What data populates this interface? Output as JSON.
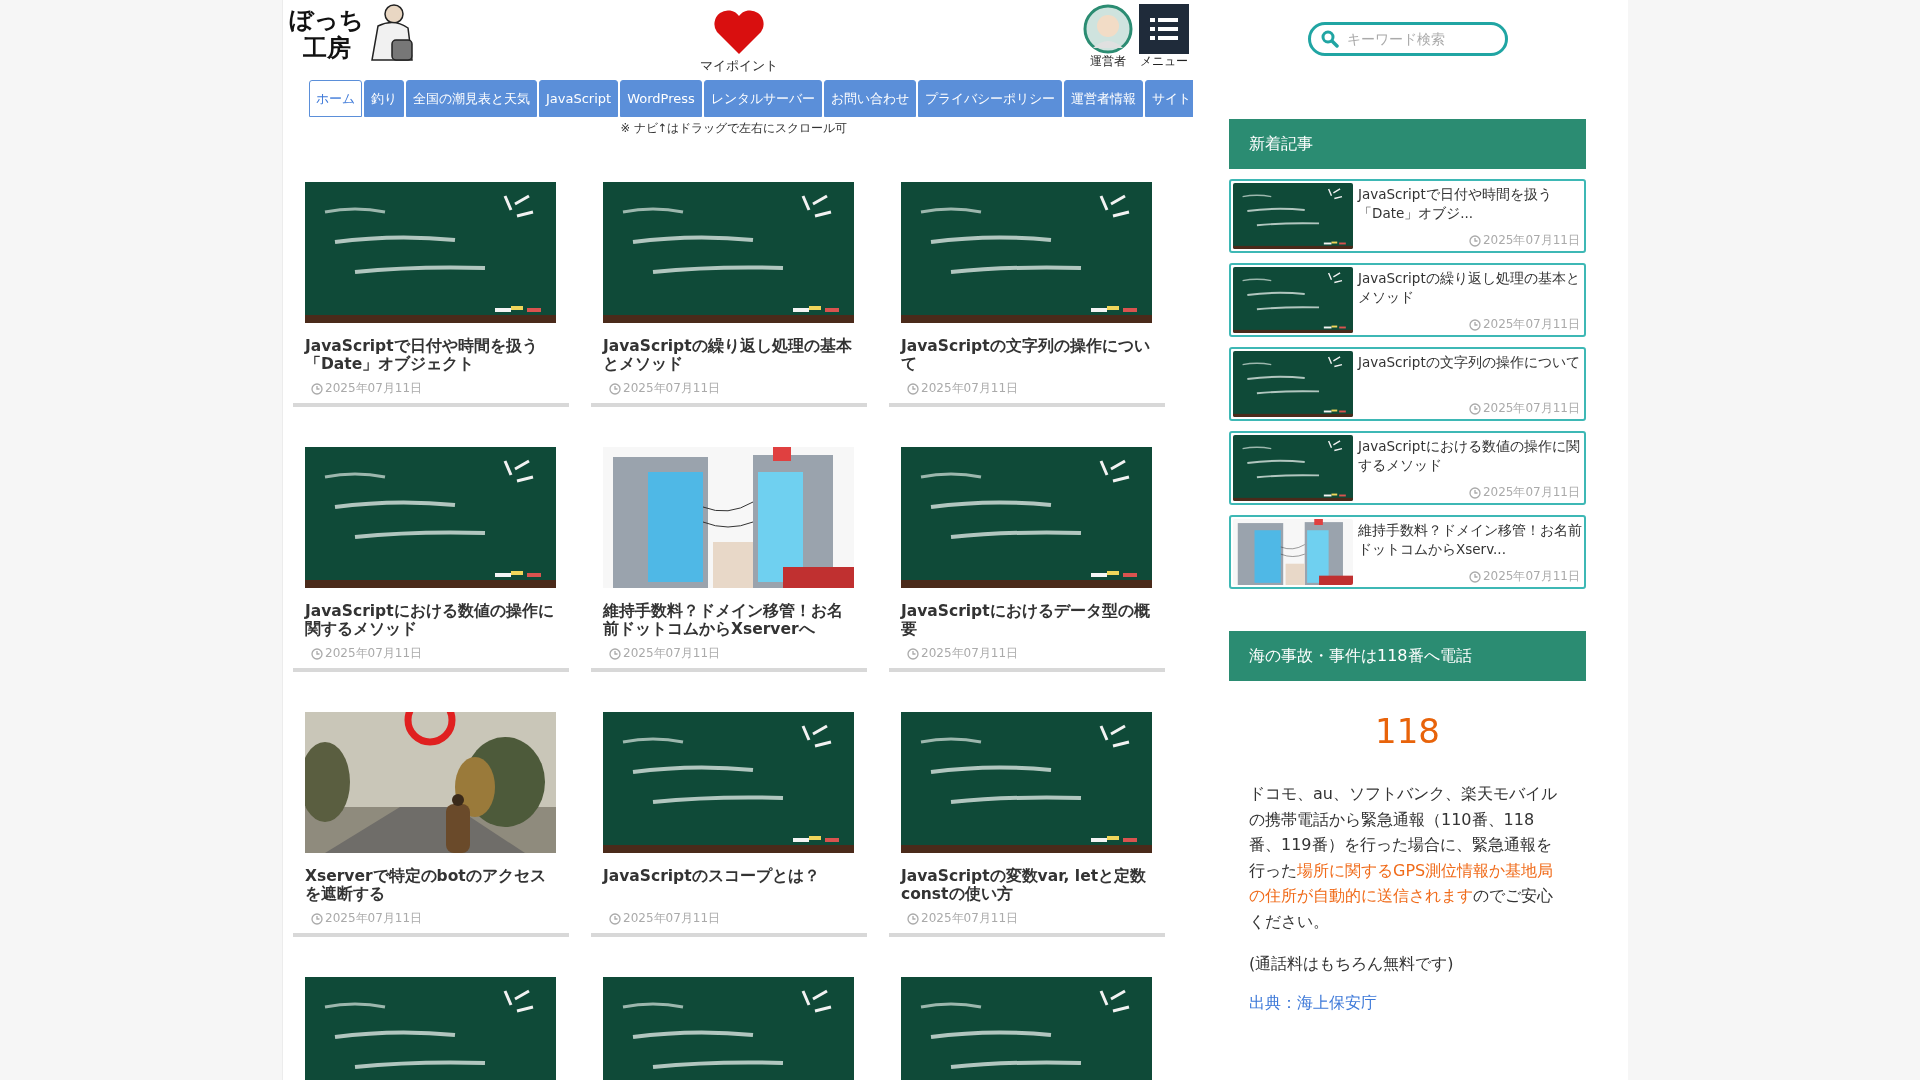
{
  "header": {
    "logo_lines": [
      "ぼっち",
      "工房"
    ],
    "mypoint_label": "マイポイント",
    "operator_label": "運営者",
    "menu_label": "メニュー"
  },
  "nav": {
    "tabs": [
      {
        "label": "ホーム",
        "selected": true
      },
      {
        "label": "釣り",
        "selected": false
      },
      {
        "label": "全国の潮見表と天気",
        "selected": false
      },
      {
        "label": "JavaScript",
        "selected": false
      },
      {
        "label": "WordPress",
        "selected": false
      },
      {
        "label": "レンタルサーバー",
        "selected": false
      },
      {
        "label": "お問い合わせ",
        "selected": false
      },
      {
        "label": "プライバシーポリシー",
        "selected": false
      },
      {
        "label": "運営者情報",
        "selected": false
      },
      {
        "label": "サイト",
        "selected": false
      }
    ],
    "note": "※ ナビ↑はドラッグで左右にスクロール可"
  },
  "articles": [
    {
      "kind": "chalkboard",
      "title": "JavaScriptで日付や時間を扱う「Date」オブジェクト",
      "date": "2025年07月11日"
    },
    {
      "kind": "chalkboard",
      "title": "JavaScriptの繰り返し処理の基本とメソッド",
      "date": "2025年07月11日"
    },
    {
      "kind": "chalkboard",
      "title": "JavaScriptの文字列の操作について",
      "date": "2025年07月11日"
    },
    {
      "kind": "chalkboard",
      "title": "JavaScriptにおける数値の操作に関するメソッド",
      "date": "2025年07月11日"
    },
    {
      "kind": "buildings",
      "title": "維持手数料？ドメイン移管！お名前ドットコムからXserverへ",
      "date": "2025年07月11日"
    },
    {
      "kind": "chalkboard",
      "title": "JavaScriptにおけるデータ型の概要",
      "date": "2025年07月11日"
    },
    {
      "kind": "road",
      "title": "Xserverで特定のbotのアクセスを遮断する",
      "date": "2025年07月11日"
    },
    {
      "kind": "chalkboard",
      "title": "JavaScriptのスコープとは？",
      "date": "2025年07月11日"
    },
    {
      "kind": "chalkboard",
      "title": "JavaScriptの変数var, letと定数constの使い方",
      "date": "2025年07月11日"
    },
    {
      "kind": "chalkboard"
    },
    {
      "kind": "chalkboard"
    },
    {
      "kind": "chalkboard"
    }
  ],
  "sidebar": {
    "search": {
      "placeholder": "キーワード検索"
    },
    "recent": {
      "title": "新着記事",
      "items": [
        {
          "kind": "chalkboard",
          "title": "JavaScriptで日付や時間を扱う「Date」オブジ...",
          "date": "2025年07月11日"
        },
        {
          "kind": "chalkboard",
          "title": "JavaScriptの繰り返し処理の基本とメソッド",
          "date": "2025年07月11日"
        },
        {
          "kind": "chalkboard",
          "title": "JavaScriptの文字列の操作について",
          "date": "2025年07月11日"
        },
        {
          "kind": "chalkboard",
          "title": "JavaScriptにおける数値の操作に関するメソッド",
          "date": "2025年07月11日"
        },
        {
          "kind": "buildings",
          "title": "維持手数料？ドメイン移管！お名前ドットコムからXserv...",
          "date": "2025年07月11日"
        }
      ]
    },
    "emergency": {
      "title": "海の事故・事件は118番へ電話",
      "number": "118",
      "body": [
        {
          "text": "ドコモ、au、ソフトバンク、楽天モバイルの携帯電話から緊急通報（110番、118番、119番）を行った場合に、緊急通報を行った",
          "highlight": false
        },
        {
          "text": "場所に関するGPS測位情報か基地局の住所が自動的に送信されます",
          "highlight": true
        },
        {
          "text": "のでご安心ください。",
          "highlight": false
        }
      ],
      "note": "(通話料はもちろん無料です)",
      "source": "出典：海上保安庁"
    }
  }
}
